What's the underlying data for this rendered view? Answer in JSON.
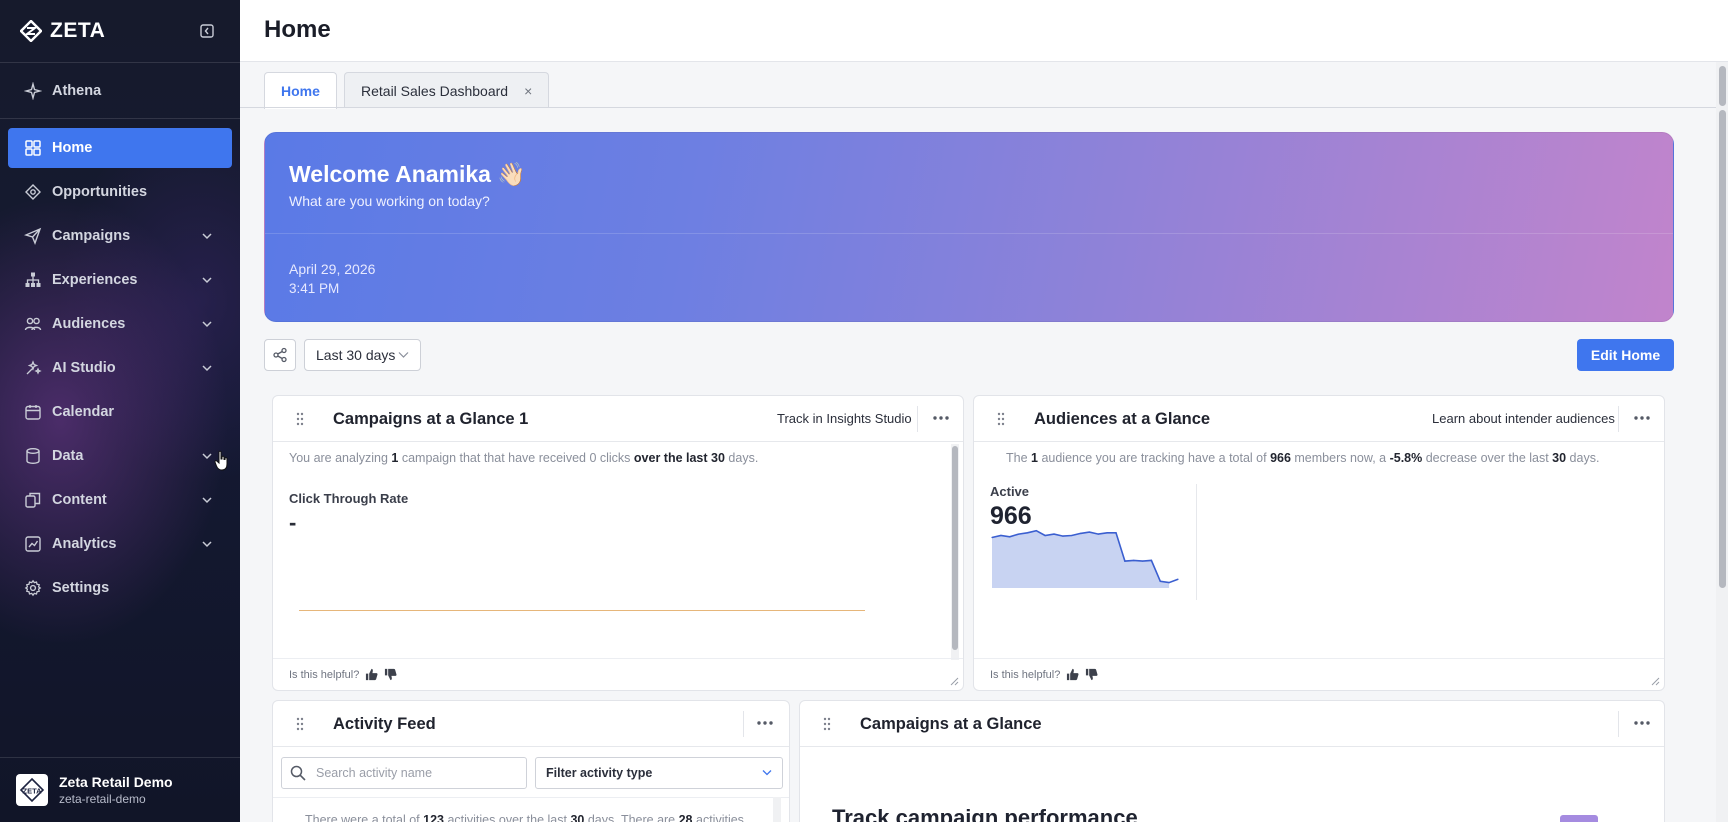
{
  "brand": {
    "name": "ZETA"
  },
  "sidebar": {
    "items": [
      {
        "label": "Athena",
        "icon": "sparkle-icon",
        "expandable": false
      },
      {
        "label": "Home",
        "icon": "grid-icon",
        "expandable": false,
        "active": true
      },
      {
        "label": "Opportunities",
        "icon": "target-icon",
        "expandable": false
      },
      {
        "label": "Campaigns",
        "icon": "send-icon",
        "expandable": true
      },
      {
        "label": "Experiences",
        "icon": "sitemap-icon",
        "expandable": true
      },
      {
        "label": "Audiences",
        "icon": "users-icon",
        "expandable": true
      },
      {
        "label": "AI Studio",
        "icon": "ai-studio-icon",
        "expandable": true
      },
      {
        "label": "Calendar",
        "icon": "calendar-icon",
        "expandable": false
      },
      {
        "label": "Data",
        "icon": "database-icon",
        "expandable": true
      },
      {
        "label": "Content",
        "icon": "content-icon",
        "expandable": true
      },
      {
        "label": "Analytics",
        "icon": "analytics-icon",
        "expandable": true
      },
      {
        "label": "Settings",
        "icon": "gear-icon",
        "expandable": false
      }
    ],
    "workspace": {
      "name": "Zeta Retail Demo",
      "slug": "zeta-retail-demo",
      "logo_text": "ZETA"
    }
  },
  "header": {
    "title": "Home"
  },
  "tabs": [
    {
      "label": "Home",
      "active": true,
      "closable": false
    },
    {
      "label": "Retail Sales Dashboard",
      "active": false,
      "closable": true,
      "close_glyph": "×"
    }
  ],
  "banner": {
    "welcome": "Welcome Anamika 👋🏻",
    "subtitle": "What are you working on today?",
    "date": "April 29, 2026",
    "time": "3:41 PM"
  },
  "controls": {
    "date_range": "Last 30 days",
    "edit_label": "Edit Home"
  },
  "cards": {
    "campaigns_glance_1": {
      "title": "Campaigns at a Glance 1",
      "link": "Track in Insights Studio",
      "desc_parts": [
        "You are analyzing ",
        "1",
        " campaign that that have received 0 clicks ",
        "over the last",
        " ",
        "30",
        " days."
      ],
      "metric_label": "Click Through Rate",
      "metric_value": "-",
      "helpful": "Is this helpful?"
    },
    "audiences_glance": {
      "title": "Audiences at a Glance",
      "link": "Learn about intender audiences",
      "desc_parts": [
        "The ",
        "1",
        " audience you are tracking have a total of ",
        "966",
        " members now, a ",
        "-5.8%",
        " decrease over the last ",
        "30",
        " days."
      ],
      "metric_label": "Active",
      "metric_value": "966",
      "helpful": "Is this helpful?"
    },
    "activity_feed": {
      "title": "Activity Feed",
      "search_placeholder": "Search activity name",
      "filter_label": "Filter activity type",
      "summary_parts": [
        "There were a total of ",
        "123",
        " activities over the last ",
        "30",
        " days. There are ",
        "28",
        " activities"
      ]
    },
    "campaigns_glance": {
      "title": "Campaigns at a Glance",
      "heading": "Track campaign performance"
    }
  },
  "colors": {
    "accent": "#3f76ee",
    "sidebar_bg": "#151a30",
    "banner_start": "#5a7ae6",
    "banner_end": "#c184cc",
    "chart_fill": "#c8d3f2",
    "chart_line": "#3b5fd0"
  },
  "chart_data": {
    "type": "area",
    "title": "",
    "series": [
      {
        "values": [
          955,
          958,
          956,
          960,
          962,
          965,
          958,
          960,
          957,
          958,
          961,
          963,
          960,
          962,
          962,
          920,
          921,
          920,
          921,
          890,
          888,
          893
        ]
      }
    ],
    "ylim": [
      880,
      975
    ],
    "grid": false,
    "legend": "none"
  }
}
